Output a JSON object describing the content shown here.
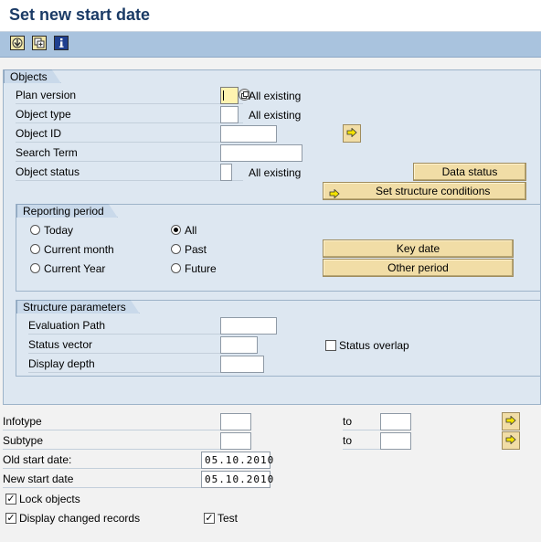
{
  "window": {
    "title": "Set new start date"
  },
  "toolbar": {
    "buttons": [
      {
        "icon": "execute-icon"
      },
      {
        "icon": "copy-selection-icon"
      },
      {
        "icon": "info-icon"
      }
    ]
  },
  "objects": {
    "tab_label": "Objects",
    "plan_version": {
      "label": "Plan version",
      "value": "",
      "note": "All existing"
    },
    "object_type": {
      "label": "Object type",
      "value": "",
      "note": "All existing"
    },
    "object_id": {
      "label": "Object ID",
      "value": ""
    },
    "search_term": {
      "label": "Search Term",
      "value": ""
    },
    "object_status": {
      "label": "Object status",
      "value": "",
      "note": "All existing"
    },
    "data_status_button": "Data status",
    "structure_conditions_button": "Set structure conditions"
  },
  "reporting_period": {
    "tab_label": "Reporting period",
    "options": {
      "today": "Today",
      "current_month": "Current month",
      "current_year": "Current Year",
      "all": "All",
      "past": "Past",
      "future": "Future"
    },
    "selected": "all",
    "key_date_button": "Key date",
    "other_period_button": "Other period"
  },
  "structure_parameters": {
    "tab_label": "Structure parameters",
    "evaluation_path": {
      "label": "Evaluation Path",
      "value": ""
    },
    "status_vector": {
      "label": "Status vector",
      "value": ""
    },
    "display_depth": {
      "label": "Display depth",
      "value": ""
    },
    "status_overlap": {
      "label": "Status overlap",
      "checked": false
    }
  },
  "lower": {
    "infotype": {
      "label": "Infotype",
      "value": "",
      "to_label": "to",
      "to_value": ""
    },
    "subtype": {
      "label": "Subtype",
      "value": "",
      "to_label": "to",
      "to_value": ""
    },
    "old_start_date": {
      "label": "Old start date:",
      "value": "05.10.2010"
    },
    "new_start_date": {
      "label": "New start date",
      "value": "05.10.2010"
    },
    "lock_objects": {
      "label": "Lock objects",
      "checked": true
    },
    "display_changed_records": {
      "label": "Display changed records",
      "checked": true
    },
    "test": {
      "label": "Test",
      "checked": true
    }
  },
  "colors": {
    "title_text": "#1b3b66",
    "toolbar_bg": "#a9c3de",
    "panel_bg": "#dde7f1",
    "button_bg": "#f1dda6",
    "required_field_bg": "#fff3b0"
  }
}
